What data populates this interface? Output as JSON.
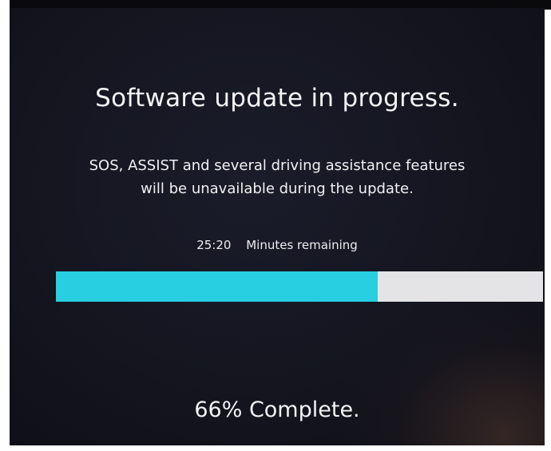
{
  "update_screen": {
    "title": "Software update in progress.",
    "message_line1": "SOS, ASSIST and several driving assistance features",
    "message_line2": "will be unavailable during the update.",
    "time_remaining": "25:20",
    "time_remaining_label": "Minutes remaining",
    "progress_fraction": 0.66,
    "complete_text": "66% Complete."
  },
  "colors": {
    "background": "#14151f",
    "text": "#f4f4f6",
    "progress_fill": "#27cfe0",
    "progress_track": "#e4e4e6"
  }
}
